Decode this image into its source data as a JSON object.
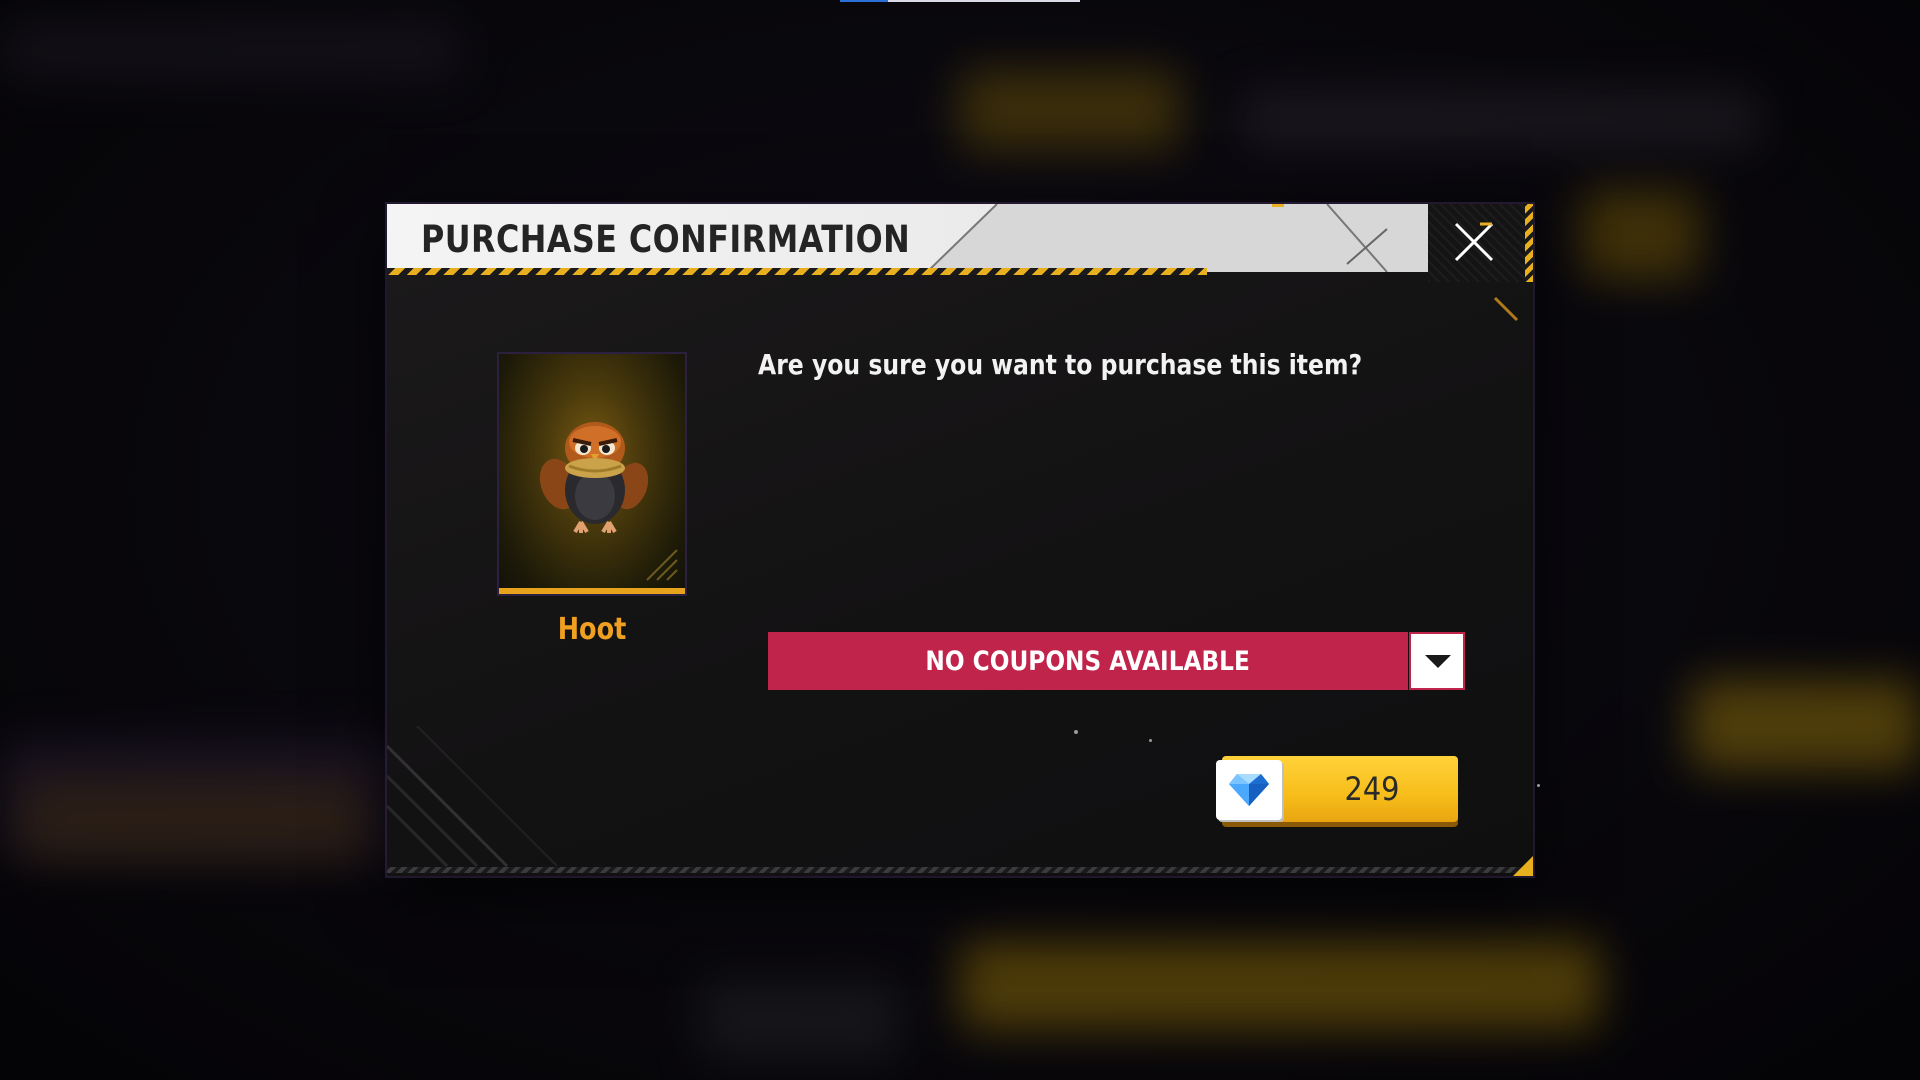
{
  "dialog": {
    "title": "PURCHASE CONFIRMATION",
    "question": "Are you sure you want to purchase this item?"
  },
  "item": {
    "name": "Hoot",
    "icon": "owl-pet-icon"
  },
  "coupon": {
    "label": "NO COUPONS AVAILABLE",
    "toggle_icon": "chevron-down-icon"
  },
  "price": {
    "amount": "249",
    "currency_icon": "diamond-icon"
  },
  "colors": {
    "title_bg": "#f0f0f0",
    "accent_yellow": "#f7bd1a",
    "coupon_red": "#c0244a",
    "item_name_orange": "#f0a020",
    "dialog_bg": "#141314"
  }
}
